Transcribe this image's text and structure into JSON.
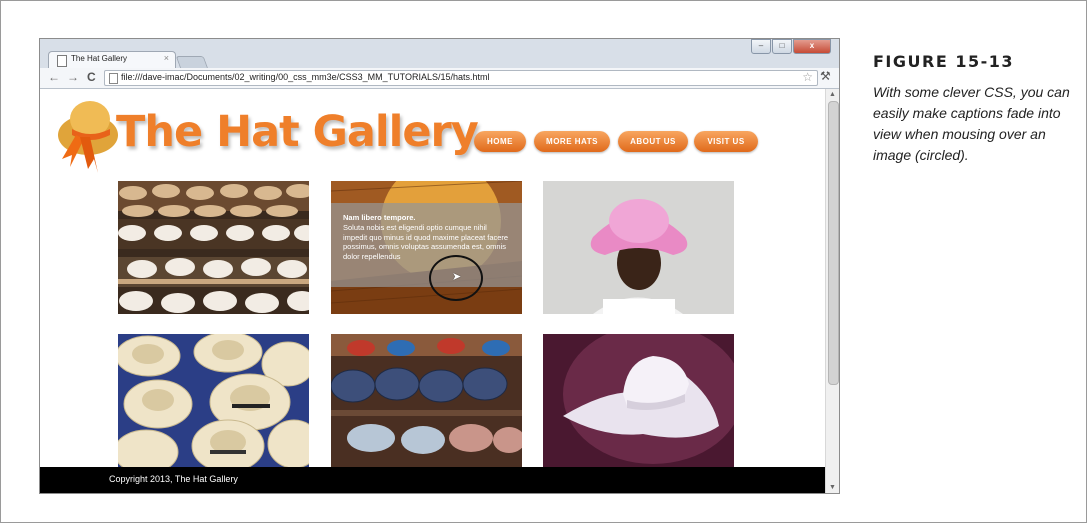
{
  "browser": {
    "tab_title": "The Hat Gallery",
    "tab_close": "×",
    "url": "file:///dave-imac/Documents/02_writing/00_css_mm3e/CSS3_MM_TUTORIALS/15/hats.html",
    "nav_back": "←",
    "nav_forward": "→",
    "nav_reload": "C",
    "bookmark_star": "☆",
    "wrench": "⚒",
    "win_min": "–",
    "win_max": "□",
    "win_close": "x",
    "scroll_up": "▲",
    "scroll_down": "▼"
  },
  "site": {
    "title": "The Hat Gallery",
    "nav": [
      "HOME",
      "MORE HATS",
      "ABOUT US",
      "VISIT US"
    ],
    "caption": {
      "title": "Nam libero tempore.",
      "body": "Soluta nobis est eligendi optio cumque nihil impedit quo minus id quod maxime placeat facere possimus, omnis voluptas assumenda est, omnis dolor repellendus"
    },
    "footer": "Copyright 2013, The Hat Gallery"
  },
  "figure": {
    "label": "FIGURE 15-13",
    "caption": "With some clever CSS, you can easily make captions fade into view when mousing over an image (circled)."
  },
  "colors": {
    "accent": "#ef7f2a",
    "footer": "#000000"
  }
}
